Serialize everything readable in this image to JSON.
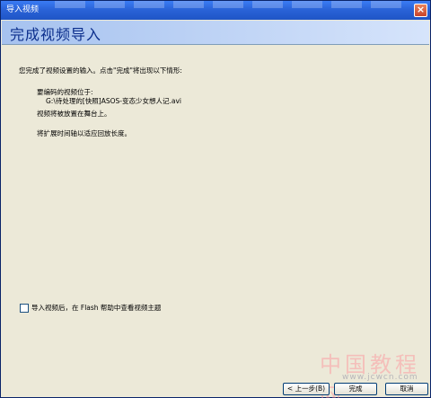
{
  "window": {
    "title": "导入视频"
  },
  "header": {
    "title": "完成视频导入"
  },
  "content": {
    "intro": "您完成了视频设置的输入。点击\"完成\"将出现以下情形:",
    "file_label": "要编码的视频位于:",
    "file_path": "G:\\待处理的[快照]ASOS-变态少女想人记.avi",
    "stage_note": "视频将被放置在舞台上。",
    "timeline_note": "将扩展时间轴以适应回放长度。"
  },
  "options": {
    "help_checkbox_label": "导入视频后，在 Flash 帮助中查看视频主题",
    "help_checkbox_checked": false
  },
  "buttons": {
    "back": "< 上一步(B)",
    "finish": "完成",
    "cancel": "取消"
  },
  "watermark": {
    "text": "中国教程网",
    "url": "www.jcwcn.com"
  },
  "colors": {
    "titlebar": "#2a63d8",
    "header_band": "#a6c2ef",
    "header_text": "#0b2e8c",
    "dialog_bg": "#ece9d8"
  }
}
